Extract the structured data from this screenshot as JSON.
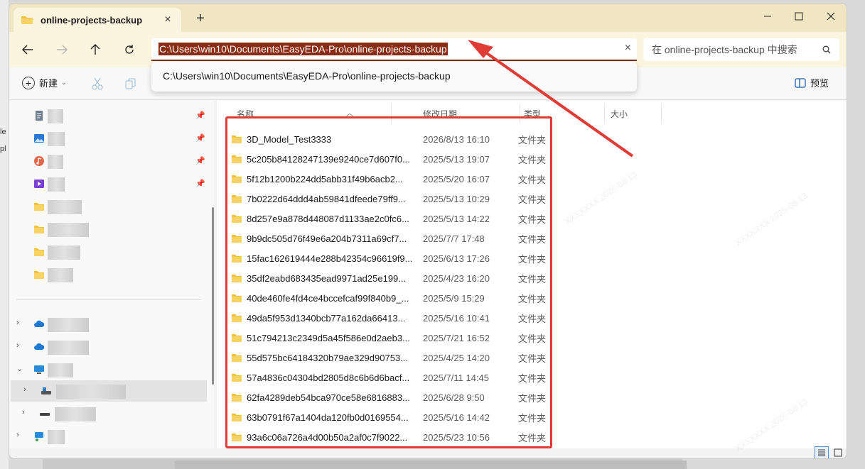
{
  "window": {
    "tab_title": "online-projects-backup",
    "new_tab_symbol": "+",
    "tab_close_symbol": "×"
  },
  "address": {
    "path": "C:\\Users\\win10\\Documents\\EasyEDA-Pro\\online-projects-backup",
    "suggestion": "C:\\Users\\win10\\Documents\\EasyEDA-Pro\\online-projects-backup"
  },
  "search": {
    "placeholder": "在 online-projects-backup 中搜索"
  },
  "toolbar": {
    "new_label": "新建",
    "preview_label": "预览"
  },
  "columns": {
    "name": "名称",
    "date": "修改日期",
    "type": "类型",
    "size": "大小"
  },
  "files": [
    {
      "name": "3D_Model_Test3333",
      "date": "2026/8/13 16:10",
      "type": "文件夹"
    },
    {
      "name": "5c205b84128247139e9240ce7d607f0...",
      "date": "2025/5/13 19:07",
      "type": "文件夹"
    },
    {
      "name": "5f12b1200b224dd5abb31f49b6acb2...",
      "date": "2025/5/20 16:07",
      "type": "文件夹"
    },
    {
      "name": "7b0222d64ddd4ab59841dfeede79ff9...",
      "date": "2025/5/13 10:29",
      "type": "文件夹"
    },
    {
      "name": "8d257e9a878d448087d1133ae2c0fc6...",
      "date": "2025/5/13 14:22",
      "type": "文件夹"
    },
    {
      "name": "9b9dc505d76f49e6a204b7311a69cf7...",
      "date": "2025/7/7 17:48",
      "type": "文件夹"
    },
    {
      "name": "15fac162619444e288b42354c96619f9...",
      "date": "2025/6/13 17:26",
      "type": "文件夹"
    },
    {
      "name": "35df2eabd683435ead9971ad25e199...",
      "date": "2025/4/23 16:20",
      "type": "文件夹"
    },
    {
      "name": "40de460fe4fd4ce4bccefcaf99f840b9_...",
      "date": "2025/5/9 15:29",
      "type": "文件夹"
    },
    {
      "name": "49da5f953d1340bcb77a162da66413...",
      "date": "2025/5/16 10:41",
      "type": "文件夹"
    },
    {
      "name": "51c794213c2349d5a45f586e0d2aeb3...",
      "date": "2025/7/21 16:52",
      "type": "文件夹"
    },
    {
      "name": "55d575bc64184320b79ae329d90753...",
      "date": "2025/4/25 14:20",
      "type": "文件夹"
    },
    {
      "name": "57a4836c04304bd2805d8c6b6d6bacf...",
      "date": "2025/7/11 14:45",
      "type": "文件夹"
    },
    {
      "name": "62fa4289deb54bca970ce58e6816883...",
      "date": "2025/6/28 9:50",
      "type": "文件夹"
    },
    {
      "name": "63b0791f67a1404da120fb0d0169554...",
      "date": "2025/5/16 14:42",
      "type": "文件夹"
    },
    {
      "name": "93a6c06a726a4d00b50a2af0c7f9022...",
      "date": "2025/5/23 10:56",
      "type": "文件夹"
    }
  ],
  "colors": {
    "folder": "#f2c13d",
    "annotation_red": "#e03b35",
    "titlebar": "#f0e6c4"
  }
}
